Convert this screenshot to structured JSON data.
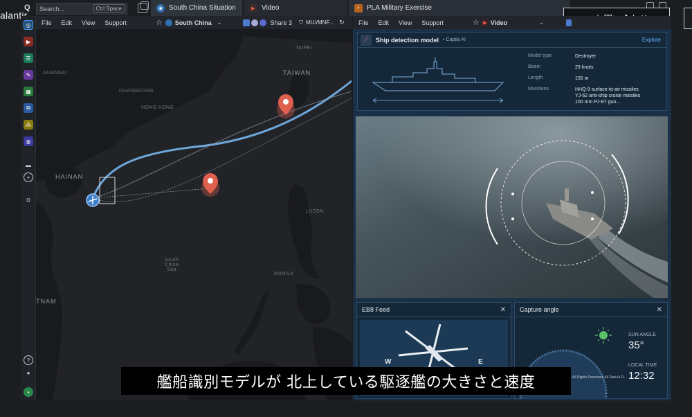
{
  "brand": "alantir",
  "search": {
    "placeholder": "Search...",
    "shortcut": "Ctrl Space"
  },
  "tabs": [
    {
      "label": "South China Situation",
      "icon": "globe-icon"
    },
    {
      "label": "Video",
      "icon": "play-icon"
    },
    {
      "label": "PLA Military Exercise",
      "icon": "search-icon"
    }
  ],
  "contact_button": "↖ お問い合わせ",
  "left_menu": {
    "items": [
      "File",
      "Edit",
      "View",
      "Support"
    ],
    "map_name": "South China",
    "share": "Share",
    "share_count": "3",
    "classification": "MU//MNF..."
  },
  "right_menu": {
    "items": [
      "File",
      "Edit",
      "View",
      "Support"
    ],
    "video_label": "Video"
  },
  "map_labels": {
    "taipei": "TAIPEI",
    "taiwan": "TAIWAN",
    "guangxi": "GUANGXI",
    "guangdong": "GUANGDONG",
    "hong_kong": "HONG KONG",
    "hainan": "HAINAN",
    "vietnam": "TNAM",
    "south_china_sea": "South\nChina\nSea",
    "manila": "MANILA",
    "luzon": "LUZON"
  },
  "ship_card": {
    "title": "Ship detection model",
    "source": "Captia AI",
    "explore": "Explore",
    "specs": [
      {
        "key": "Model type",
        "value": "Destroyer"
      },
      {
        "key": "Beam",
        "value": "29 knots"
      },
      {
        "key": "Length",
        "value": "155 m"
      },
      {
        "key": "Munitions",
        "value": "HHQ-9 surface-to-air missiles\nYJ-62 anti-ship cruise missiles\n100 mm PJ-87 gun..."
      }
    ]
  },
  "feed_left": {
    "title": "EB8 Feed",
    "compass_w": "W",
    "compass_e": "E"
  },
  "feed_right": {
    "title": "Capture angle",
    "sun_angle_label": "SUN ANGLE",
    "sun_angle_value": "35°",
    "local_time_label": "LOCAL TIME",
    "local_time_value": "12:32",
    "copyright": "s. All Rights Reserved. All Data Is Fi..."
  },
  "caption": "艦船識別モデルが 北上している駆逐艦の大きさと速度",
  "colors": {
    "accent": "#4aa3ff",
    "alert": "#e0604f",
    "track": "#6fa8dc",
    "panel": "#15283a"
  }
}
